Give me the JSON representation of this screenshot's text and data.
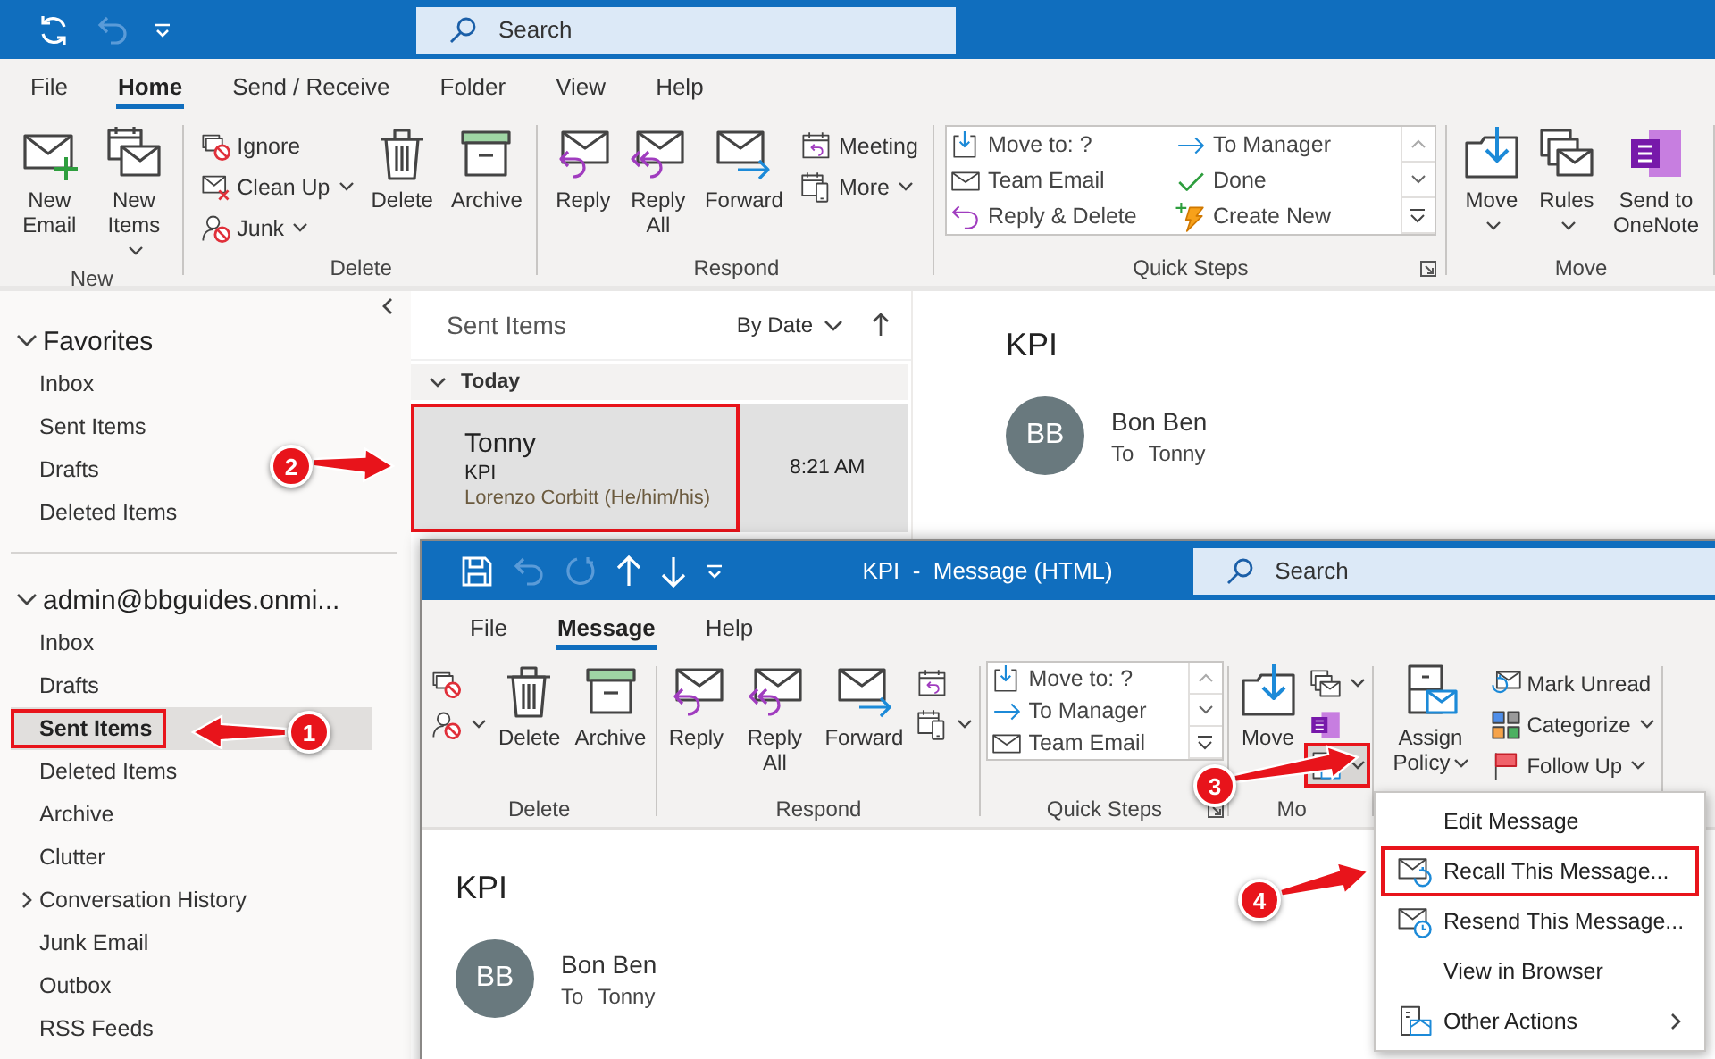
{
  "app_window": {
    "search_placeholder": "Search"
  },
  "tabs": [
    {
      "label": "File",
      "selected": false
    },
    {
      "label": "Home",
      "selected": true
    },
    {
      "label": "Send / Receive",
      "selected": false
    },
    {
      "label": "Folder",
      "selected": false
    },
    {
      "label": "View",
      "selected": false
    },
    {
      "label": "Help",
      "selected": false
    }
  ],
  "ribbon": [
    {
      "label": "New",
      "launcher": false,
      "items": [
        {
          "kind": "large",
          "label": "New Email",
          "dropdown": false
        },
        {
          "kind": "large",
          "label": "New Items",
          "dropdown": true
        }
      ]
    },
    {
      "label": "Delete",
      "launcher": false,
      "items": [
        {
          "kind": "stack",
          "buttons": [
            {
              "label": "Ignore",
              "dropdown": false
            },
            {
              "label": "Clean Up",
              "dropdown": true
            },
            {
              "label": "Junk",
              "dropdown": true
            }
          ]
        },
        {
          "kind": "large",
          "label": "Delete",
          "dropdown": false
        },
        {
          "kind": "large",
          "label": "Archive",
          "dropdown": false
        }
      ]
    },
    {
      "label": "Respond",
      "launcher": false,
      "items": [
        {
          "kind": "large",
          "label": "Reply",
          "dropdown": false
        },
        {
          "kind": "large",
          "label": "Reply All",
          "dropdown": false
        },
        {
          "kind": "large",
          "label": "Forward",
          "dropdown": false
        },
        {
          "kind": "stack",
          "buttons": [
            {
              "label": "Meeting",
              "dropdown": false
            },
            {
              "label": "More",
              "dropdown": true
            }
          ]
        }
      ]
    },
    {
      "label": "Quick Steps",
      "launcher": true,
      "items": [
        {
          "kind": "gallery",
          "steps": [
            {
              "label": "Move to: ?"
            },
            {
              "label": "To Manager"
            },
            {
              "label": "Team Email"
            },
            {
              "label": "Done"
            },
            {
              "label": "Reply & Delete"
            },
            {
              "label": "Create New"
            }
          ]
        }
      ]
    },
    {
      "label": "Move",
      "launcher": false,
      "items": [
        {
          "kind": "large",
          "label": "Move",
          "dropdown": true
        },
        {
          "kind": "large",
          "label": "Rules",
          "dropdown": true
        },
        {
          "kind": "large",
          "label": "Send to OneNote",
          "dropdown": false
        }
      ]
    }
  ],
  "folder_pane": {
    "sections": [
      {
        "title": "Favorites",
        "expanded": true,
        "folders": [
          {
            "name": "Inbox",
            "selected": false,
            "highlighted": false
          },
          {
            "name": "Sent Items",
            "selected": false,
            "highlighted": false
          },
          {
            "name": "Drafts",
            "selected": false,
            "highlighted": false
          },
          {
            "name": "Deleted Items",
            "selected": false,
            "highlighted": false
          }
        ]
      },
      {
        "title": "admin@bbguides.onmi...",
        "expanded": true,
        "folders": [
          {
            "name": "Inbox",
            "selected": false,
            "highlighted": false
          },
          {
            "name": "Drafts",
            "selected": false,
            "highlighted": false
          },
          {
            "name": "Sent Items",
            "selected": true,
            "highlighted": true
          },
          {
            "name": "Deleted Items",
            "selected": false,
            "highlighted": false
          },
          {
            "name": "Archive",
            "selected": false,
            "highlighted": false
          },
          {
            "name": "Clutter",
            "selected": false,
            "highlighted": false
          },
          {
            "name": "Conversation History",
            "selected": false,
            "highlighted": false,
            "expanded": false
          },
          {
            "name": "Junk Email",
            "selected": false,
            "highlighted": false
          },
          {
            "name": "Outbox",
            "selected": false,
            "highlighted": false
          },
          {
            "name": "RSS Feeds",
            "selected": false,
            "highlighted": false
          }
        ]
      }
    ]
  },
  "message_list": {
    "title": "Sent Items",
    "sort": "By Date",
    "groups": [
      {
        "label": "Today",
        "expanded": true,
        "messages": [
          {
            "sender": "Tonny",
            "subject": "KPI",
            "preview": "Lorenzo Corbitt (He/him/his)",
            "time": "8:21 AM",
            "selected": true,
            "highlighted": true
          }
        ]
      }
    ]
  },
  "reading_pane": {
    "subject": "KPI",
    "initials": "BB",
    "sender": "Bon Ben",
    "to_label": "To",
    "to": "Tonny"
  },
  "message_window": {
    "title": "KPI  -  Message (HTML)",
    "search_placeholder": "Search",
    "tabs": [
      {
        "label": "File",
        "selected": false
      },
      {
        "label": "Message",
        "selected": true
      },
      {
        "label": "Help",
        "selected": false
      }
    ],
    "ribbon": [
      {
        "label": "Delete",
        "launcher": false,
        "items": [
          {
            "kind": "stack",
            "buttons": [
              {
                "dropdown": false,
                "highlighted": false
              },
              {
                "dropdown": true,
                "highlighted": false
              }
            ]
          },
          {
            "kind": "large",
            "label": "Delete",
            "dropdown": false
          },
          {
            "kind": "large",
            "label": "Archive",
            "dropdown": false
          }
        ]
      },
      {
        "label": "Respond",
        "launcher": false,
        "items": [
          {
            "kind": "large",
            "label": "Reply",
            "dropdown": false
          },
          {
            "kind": "large",
            "label": "Reply All",
            "dropdown": false
          },
          {
            "kind": "large",
            "label": "Forward",
            "dropdown": false
          },
          {
            "kind": "stack",
            "buttons": [
              {
                "dropdown": false,
                "highlighted": false
              },
              {
                "dropdown": true,
                "highlighted": false
              }
            ]
          }
        ]
      },
      {
        "label": "Quick Steps",
        "launcher": true,
        "items": [
          {
            "kind": "gallery",
            "steps": [
              {
                "label": "Move to: ?"
              },
              {
                "label": "To Manager"
              },
              {
                "label": "Team Email"
              }
            ]
          }
        ]
      },
      {
        "label": "Mo",
        "launcher": false,
        "items": [
          {
            "kind": "large",
            "label": "Move",
            "dropdown": false
          },
          {
            "kind": "stack",
            "buttons": [
              {
                "dropdown": true,
                "highlighted": false
              },
              {
                "dropdown": false,
                "highlighted": false
              },
              {
                "dropdown": true,
                "highlighted": true
              }
            ]
          }
        ]
      },
      {
        "launcher": false,
        "items": [
          {
            "kind": "large",
            "label": "Assign Policy",
            "dropdown": true
          },
          {
            "kind": "stack",
            "buttons": [
              {
                "label": "Mark Unread",
                "dropdown": false
              },
              {
                "label": "Categorize",
                "dropdown": true
              },
              {
                "label": "Follow Up",
                "dropdown": true
              }
            ]
          }
        ]
      }
    ],
    "body": {
      "subject": "KPI",
      "initials": "BB",
      "sender": "Bon Ben",
      "to_label": "To",
      "to": "Tonny"
    }
  },
  "context_menu": {
    "items": [
      {
        "label": "Edit Message",
        "highlighted": false,
        "submenu": false
      },
      {
        "label": "Recall This Message...",
        "highlighted": true,
        "submenu": false
      },
      {
        "label": "Resend This Message...",
        "highlighted": false,
        "submenu": false
      },
      {
        "label": "View in Browser",
        "highlighted": false,
        "submenu": false
      },
      {
        "label": "Other Actions",
        "highlighted": false,
        "submenu": true
      }
    ]
  },
  "annotations": [
    {
      "number": "1"
    },
    {
      "number": "2"
    },
    {
      "number": "3"
    },
    {
      "number": "4"
    }
  ]
}
